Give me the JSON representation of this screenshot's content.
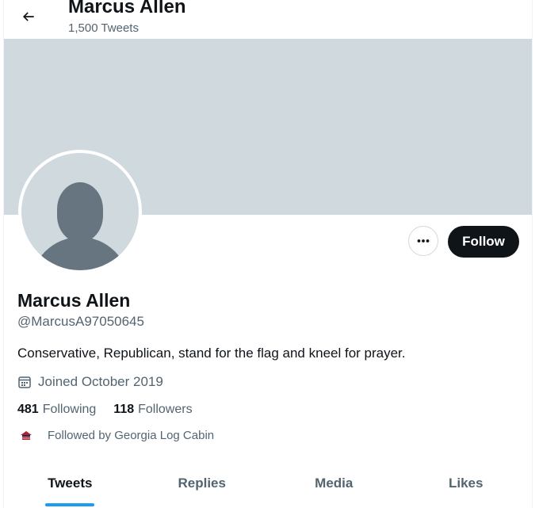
{
  "header": {
    "title": "Marcus Allen",
    "tweet_count": "1,500 Tweets"
  },
  "profile": {
    "name": "Marcus Allen",
    "handle": "@MarcusA97050645",
    "bio": "Conservative, Republican, stand for the flag and kneel for prayer.",
    "joined": "Joined October 2019",
    "following_count": "481",
    "following_label": "Following",
    "followers_count": "118",
    "followers_label": "Followers",
    "followed_by": "Followed by Georgia Log Cabin"
  },
  "actions": {
    "follow_label": "Follow",
    "more_icon": "more-horizontal-icon"
  },
  "tabs": [
    {
      "label": "Tweets",
      "active": true
    },
    {
      "label": "Replies",
      "active": false
    },
    {
      "label": "Media",
      "active": false
    },
    {
      "label": "Likes",
      "active": false
    }
  ],
  "colors": {
    "banner": "#cfd9de",
    "accent": "#1d9bf0",
    "text_primary": "#0f1419",
    "text_secondary": "#536471",
    "follow_button": "#0f1419"
  }
}
